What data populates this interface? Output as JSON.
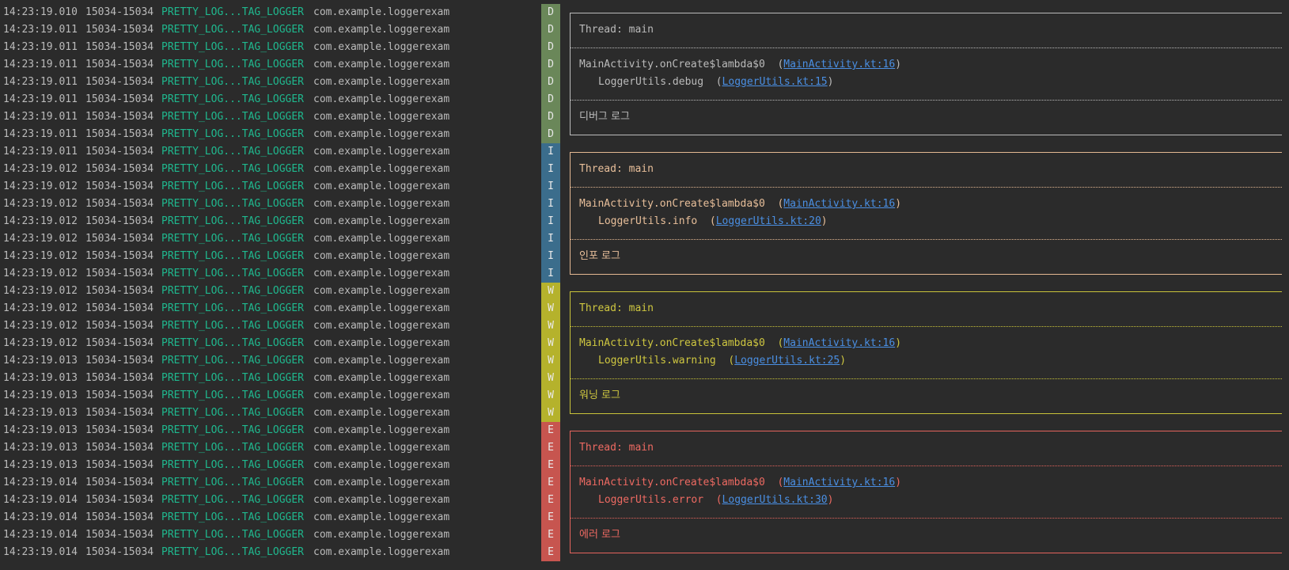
{
  "colors": {
    "D": {
      "badge": "#6a8759",
      "line": "#bbbbbb",
      "text": "#bbbbbb"
    },
    "I": {
      "badge": "#3b6d8c",
      "line": "#e3b892",
      "text": "#e8bf9a"
    },
    "W": {
      "badge": "#b5b22c",
      "line": "#c9c33a",
      "text": "#cfc740"
    },
    "E": {
      "badge": "#c7554f",
      "line": "#e5645d",
      "text": "#ee6a62"
    },
    "link": "#4a8fe3"
  },
  "rows": [
    {
      "ts": "14:23:19.010",
      "pid": "15034-15034",
      "tag": "PRETTY_LOG...TAG_LOGGER",
      "pkg": "com.example.loggerexam",
      "lvl": "D"
    },
    {
      "ts": "14:23:19.011",
      "pid": "15034-15034",
      "tag": "PRETTY_LOG...TAG_LOGGER",
      "pkg": "com.example.loggerexam",
      "lvl": "D"
    },
    {
      "ts": "14:23:19.011",
      "pid": "15034-15034",
      "tag": "PRETTY_LOG...TAG_LOGGER",
      "pkg": "com.example.loggerexam",
      "lvl": "D"
    },
    {
      "ts": "14:23:19.011",
      "pid": "15034-15034",
      "tag": "PRETTY_LOG...TAG_LOGGER",
      "pkg": "com.example.loggerexam",
      "lvl": "D"
    },
    {
      "ts": "14:23:19.011",
      "pid": "15034-15034",
      "tag": "PRETTY_LOG...TAG_LOGGER",
      "pkg": "com.example.loggerexam",
      "lvl": "D"
    },
    {
      "ts": "14:23:19.011",
      "pid": "15034-15034",
      "tag": "PRETTY_LOG...TAG_LOGGER",
      "pkg": "com.example.loggerexam",
      "lvl": "D"
    },
    {
      "ts": "14:23:19.011",
      "pid": "15034-15034",
      "tag": "PRETTY_LOG...TAG_LOGGER",
      "pkg": "com.example.loggerexam",
      "lvl": "D"
    },
    {
      "ts": "14:23:19.011",
      "pid": "15034-15034",
      "tag": "PRETTY_LOG...TAG_LOGGER",
      "pkg": "com.example.loggerexam",
      "lvl": "D"
    },
    {
      "ts": "14:23:19.011",
      "pid": "15034-15034",
      "tag": "PRETTY_LOG...TAG_LOGGER",
      "pkg": "com.example.loggerexam",
      "lvl": "I"
    },
    {
      "ts": "14:23:19.012",
      "pid": "15034-15034",
      "tag": "PRETTY_LOG...TAG_LOGGER",
      "pkg": "com.example.loggerexam",
      "lvl": "I"
    },
    {
      "ts": "14:23:19.012",
      "pid": "15034-15034",
      "tag": "PRETTY_LOG...TAG_LOGGER",
      "pkg": "com.example.loggerexam",
      "lvl": "I"
    },
    {
      "ts": "14:23:19.012",
      "pid": "15034-15034",
      "tag": "PRETTY_LOG...TAG_LOGGER",
      "pkg": "com.example.loggerexam",
      "lvl": "I"
    },
    {
      "ts": "14:23:19.012",
      "pid": "15034-15034",
      "tag": "PRETTY_LOG...TAG_LOGGER",
      "pkg": "com.example.loggerexam",
      "lvl": "I"
    },
    {
      "ts": "14:23:19.012",
      "pid": "15034-15034",
      "tag": "PRETTY_LOG...TAG_LOGGER",
      "pkg": "com.example.loggerexam",
      "lvl": "I"
    },
    {
      "ts": "14:23:19.012",
      "pid": "15034-15034",
      "tag": "PRETTY_LOG...TAG_LOGGER",
      "pkg": "com.example.loggerexam",
      "lvl": "I"
    },
    {
      "ts": "14:23:19.012",
      "pid": "15034-15034",
      "tag": "PRETTY_LOG...TAG_LOGGER",
      "pkg": "com.example.loggerexam",
      "lvl": "I"
    },
    {
      "ts": "14:23:19.012",
      "pid": "15034-15034",
      "tag": "PRETTY_LOG...TAG_LOGGER",
      "pkg": "com.example.loggerexam",
      "lvl": "W"
    },
    {
      "ts": "14:23:19.012",
      "pid": "15034-15034",
      "tag": "PRETTY_LOG...TAG_LOGGER",
      "pkg": "com.example.loggerexam",
      "lvl": "W"
    },
    {
      "ts": "14:23:19.012",
      "pid": "15034-15034",
      "tag": "PRETTY_LOG...TAG_LOGGER",
      "pkg": "com.example.loggerexam",
      "lvl": "W"
    },
    {
      "ts": "14:23:19.012",
      "pid": "15034-15034",
      "tag": "PRETTY_LOG...TAG_LOGGER",
      "pkg": "com.example.loggerexam",
      "lvl": "W"
    },
    {
      "ts": "14:23:19.013",
      "pid": "15034-15034",
      "tag": "PRETTY_LOG...TAG_LOGGER",
      "pkg": "com.example.loggerexam",
      "lvl": "W"
    },
    {
      "ts": "14:23:19.013",
      "pid": "15034-15034",
      "tag": "PRETTY_LOG...TAG_LOGGER",
      "pkg": "com.example.loggerexam",
      "lvl": "W"
    },
    {
      "ts": "14:23:19.013",
      "pid": "15034-15034",
      "tag": "PRETTY_LOG...TAG_LOGGER",
      "pkg": "com.example.loggerexam",
      "lvl": "W"
    },
    {
      "ts": "14:23:19.013",
      "pid": "15034-15034",
      "tag": "PRETTY_LOG...TAG_LOGGER",
      "pkg": "com.example.loggerexam",
      "lvl": "W"
    },
    {
      "ts": "14:23:19.013",
      "pid": "15034-15034",
      "tag": "PRETTY_LOG...TAG_LOGGER",
      "pkg": "com.example.loggerexam",
      "lvl": "E"
    },
    {
      "ts": "14:23:19.013",
      "pid": "15034-15034",
      "tag": "PRETTY_LOG...TAG_LOGGER",
      "pkg": "com.example.loggerexam",
      "lvl": "E"
    },
    {
      "ts": "14:23:19.013",
      "pid": "15034-15034",
      "tag": "PRETTY_LOG...TAG_LOGGER",
      "pkg": "com.example.loggerexam",
      "lvl": "E"
    },
    {
      "ts": "14:23:19.014",
      "pid": "15034-15034",
      "tag": "PRETTY_LOG...TAG_LOGGER",
      "pkg": "com.example.loggerexam",
      "lvl": "E"
    },
    {
      "ts": "14:23:19.014",
      "pid": "15034-15034",
      "tag": "PRETTY_LOG...TAG_LOGGER",
      "pkg": "com.example.loggerexam",
      "lvl": "E"
    },
    {
      "ts": "14:23:19.014",
      "pid": "15034-15034",
      "tag": "PRETTY_LOG...TAG_LOGGER",
      "pkg": "com.example.loggerexam",
      "lvl": "E"
    },
    {
      "ts": "14:23:19.014",
      "pid": "15034-15034",
      "tag": "PRETTY_LOG...TAG_LOGGER",
      "pkg": "com.example.loggerexam",
      "lvl": "E"
    },
    {
      "ts": "14:23:19.014",
      "pid": "15034-15034",
      "tag": "PRETTY_LOG...TAG_LOGGER",
      "pkg": "com.example.loggerexam",
      "lvl": "E"
    }
  ],
  "blocks": [
    {
      "lvl": "D",
      "thread": "Thread: main",
      "caller": "MainActivity.onCreate$lambda$0",
      "caller_link": "MainActivity.kt:16",
      "method": "LoggerUtils.debug",
      "method_link": "LoggerUtils.kt:15",
      "message": "디버그 로그"
    },
    {
      "lvl": "I",
      "thread": "Thread: main",
      "caller": "MainActivity.onCreate$lambda$0",
      "caller_link": "MainActivity.kt:16",
      "method": "LoggerUtils.info",
      "method_link": "LoggerUtils.kt:20",
      "message": "인포 로그"
    },
    {
      "lvl": "W",
      "thread": "Thread: main",
      "caller": "MainActivity.onCreate$lambda$0",
      "caller_link": "MainActivity.kt:16",
      "method": "LoggerUtils.warning",
      "method_link": "LoggerUtils.kt:25",
      "message": "워닝 로그"
    },
    {
      "lvl": "E",
      "thread": "Thread: main",
      "caller": "MainActivity.onCreate$lambda$0",
      "caller_link": "MainActivity.kt:16",
      "method": "LoggerUtils.error",
      "method_link": "LoggerUtils.kt:30",
      "message": "에러 로그"
    }
  ]
}
